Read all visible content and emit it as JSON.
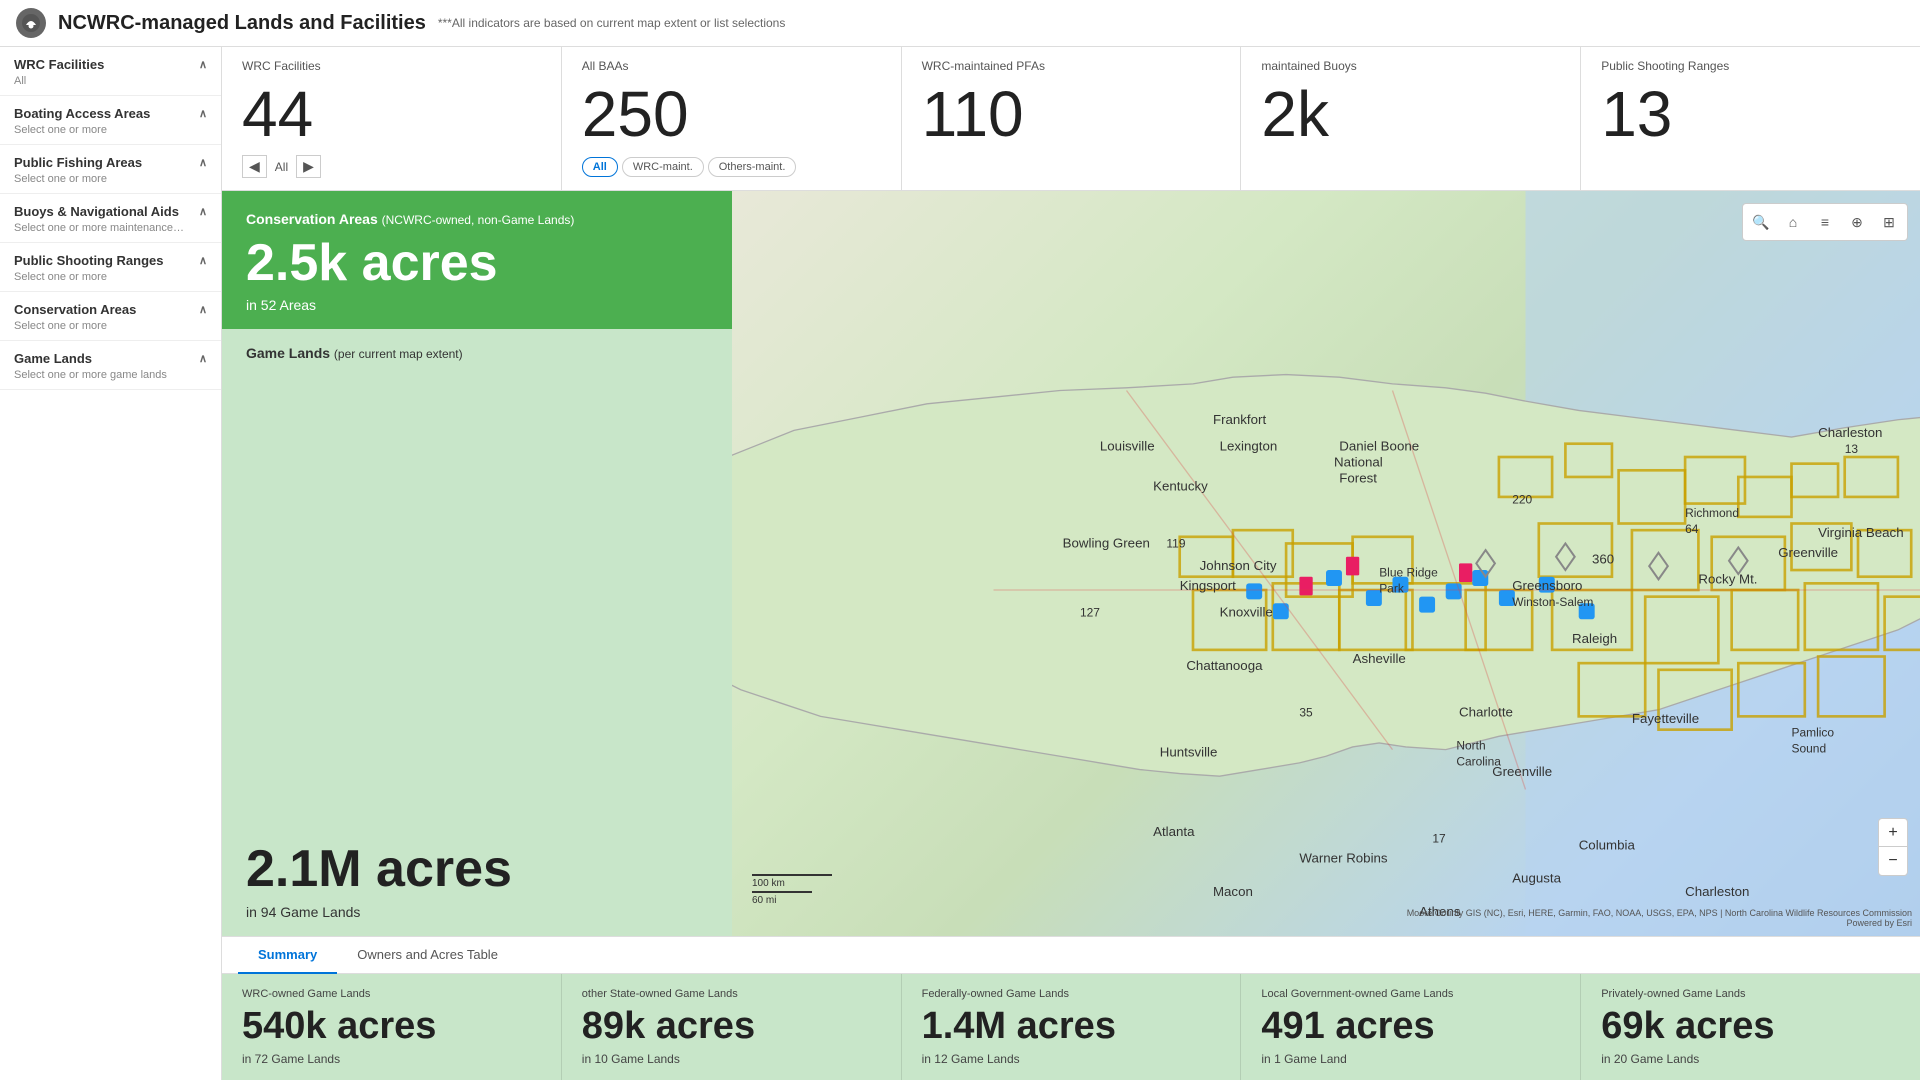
{
  "header": {
    "title": "NCWRC-managed Lands and Facilities",
    "subtitle": "***All indicators are based on current map extent or list selections",
    "logo_text": "🦅"
  },
  "sidebar": {
    "items": [
      {
        "id": "wrc-facilities",
        "title": "WRC Facilities",
        "subtitle": "All",
        "expanded": true
      },
      {
        "id": "boating-access",
        "title": "Boating Access Areas",
        "subtitle": "Select one or more",
        "expanded": true
      },
      {
        "id": "public-fishing",
        "title": "Public Fishing Areas",
        "subtitle": "Select one or more",
        "expanded": true
      },
      {
        "id": "buoys",
        "title": "Buoys & Navigational Aids",
        "subtitle": "Select one or more maintenance…",
        "expanded": true
      },
      {
        "id": "shooting-ranges",
        "title": "Public Shooting Ranges",
        "subtitle": "Select one or more",
        "expanded": true
      },
      {
        "id": "conservation-areas",
        "title": "Conservation Areas",
        "subtitle": "Select one or more",
        "expanded": true
      },
      {
        "id": "game-lands",
        "title": "Game Lands",
        "subtitle": "Select one or more game lands",
        "expanded": true
      }
    ]
  },
  "stats_bar": {
    "cards": [
      {
        "id": "wrc-facilities",
        "label": "WRC Facilities",
        "value": "44",
        "nav_label": "All",
        "has_nav": true
      },
      {
        "id": "all-baas",
        "label": "All BAAs",
        "value": "250",
        "has_tabs": true,
        "tabs": [
          "All",
          "WRC-maint.",
          "Others-maint."
        ],
        "active_tab": "All"
      },
      {
        "id": "wrc-pfas",
        "label": "WRC-maintained PFAs",
        "value": "110"
      },
      {
        "id": "buoys",
        "label": "maintained Buoys",
        "value": "2k"
      },
      {
        "id": "shooting-ranges",
        "label": "Public Shooting Ranges",
        "value": "13"
      }
    ]
  },
  "conservation_card": {
    "title": "Conservation Areas",
    "title_sub": "(NCWRC-owned, non-Game Lands)",
    "acres": "2.5k acres",
    "sub": "in 52 Areas"
  },
  "game_lands_card": {
    "title": "Game Lands",
    "title_sub": "(per current map extent)",
    "acres": "2.1M acres",
    "sub": "in 94 Game Lands"
  },
  "map": {
    "attribution": "Powered by Esri",
    "source_text": "Moore County GIS (NC), Esri, HERE, Garmin, FAO, NOAA, USGS, EPA, NPS | North Carolina Wildlife Resources Commission",
    "scale_label1": "100 km",
    "scale_label2": "60 mi"
  },
  "bottom_tabs": [
    {
      "id": "summary",
      "label": "Summary",
      "active": true
    },
    {
      "id": "owners-table",
      "label": "Owners and Acres Table",
      "active": false
    }
  ],
  "bottom_stats": [
    {
      "label": "WRC-owned Game Lands",
      "value": "540k acres",
      "sub": "in 72 Game Lands"
    },
    {
      "label": "other State-owned Game Lands",
      "value": "89k acres",
      "sub": "in 10 Game Lands"
    },
    {
      "label": "Federally-owned Game Lands",
      "value": "1.4M acres",
      "sub": "in 12 Game Lands"
    },
    {
      "label": "Local Government-owned Game Lands",
      "value": "491 acres",
      "sub": "in 1 Game Land"
    },
    {
      "label": "Privately-owned Game Lands",
      "value": "69k acres",
      "sub": "in 20 Game Lands"
    }
  ],
  "map_tools": [
    "🔍",
    "🏠",
    "☰",
    "⊕",
    "⊞"
  ]
}
